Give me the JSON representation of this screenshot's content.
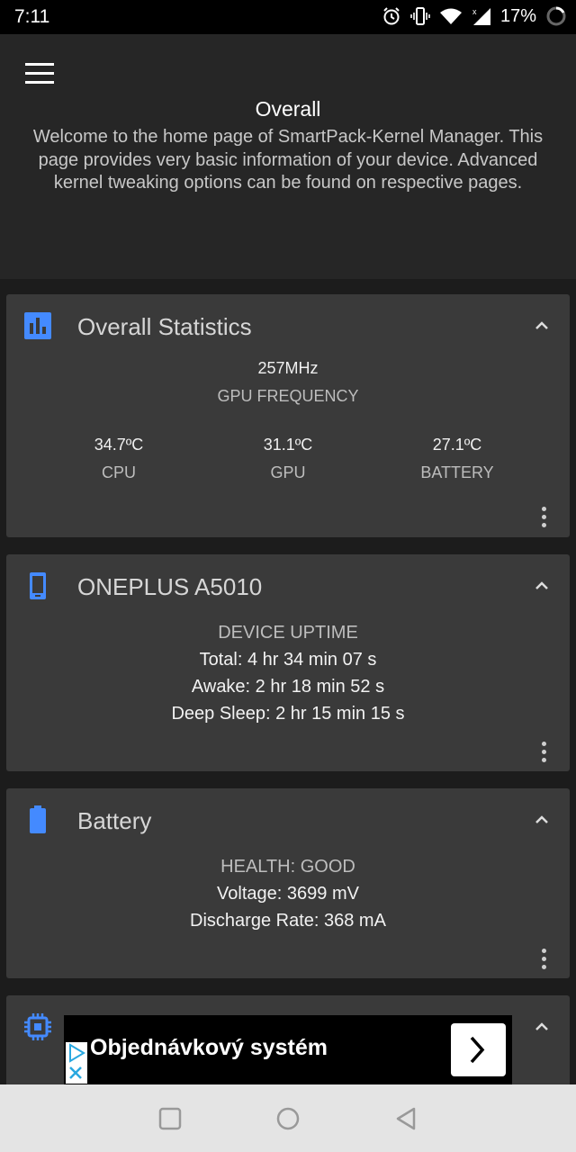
{
  "status_bar": {
    "time": "7:11",
    "battery_percent": "17%",
    "icons": [
      "alarm-icon",
      "vibrate-icon",
      "wifi-icon",
      "signal-icon",
      "battery-icon"
    ]
  },
  "header": {
    "title": "Overall",
    "description": "Welcome to the home page of SmartPack-Kernel Manager. This page provides very basic information of your device. Advanced kernel tweaking options can be found on respective pages."
  },
  "cards": {
    "stats": {
      "title": "Overall Statistics",
      "icon": "bar-chart-icon",
      "gpu_freq_value": "257MHz",
      "gpu_freq_label": "GPU FREQUENCY",
      "temps": [
        {
          "value": "34.7ºC",
          "label": "CPU"
        },
        {
          "value": "31.1ºC",
          "label": "GPU"
        },
        {
          "value": "27.1ºC",
          "label": "BATTERY"
        }
      ]
    },
    "device": {
      "title": "ONEPLUS A5010",
      "icon": "phone-icon",
      "uptime_label": "DEVICE UPTIME",
      "total": "Total: 4 hr 34 min 07 s",
      "awake": "Awake: 2 hr 18 min 52 s",
      "deep_sleep": "Deep Sleep: 2 hr 15 min 15 s"
    },
    "battery": {
      "title": "Battery",
      "icon": "battery-icon",
      "health": "HEALTH: GOOD",
      "voltage": "Voltage: 3699 mV",
      "discharge": "Discharge Rate: 368 mA"
    },
    "cpu": {
      "icon": "chip-icon"
    }
  },
  "ad": {
    "text": "Objednávkový systém"
  },
  "colors": {
    "accent": "#448aff",
    "card": "#3a3a3a",
    "header": "#262626",
    "background": "#1c1c1c"
  }
}
